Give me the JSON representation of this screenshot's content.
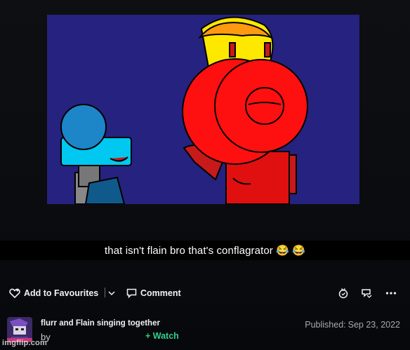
{
  "caption": {
    "text": "that isn't flain bro that's conflagrator 😂 😂"
  },
  "toolbar": {
    "favourites_label": "Add to Favourites",
    "comment_label": "Comment"
  },
  "post": {
    "title": "flurr and Flain singing together",
    "by_label": "by",
    "watch_label": "+ Watch",
    "published_label": "Published:",
    "published_date": "Sep 23, 2022"
  },
  "watermark": "imgflip.com",
  "colors": {
    "background": "#0b0d11",
    "artwork_bg": "#262280",
    "accent_green": "#2fd08a"
  },
  "icons": [
    "heart-add-icon",
    "chevron-down-icon",
    "comment-icon",
    "badge-icon",
    "share-icon",
    "more-icon"
  ]
}
